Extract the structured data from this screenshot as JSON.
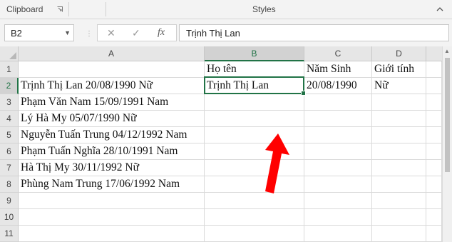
{
  "ribbon": {
    "clipboard_label": "Clipboard",
    "styles_label": "Styles"
  },
  "formula_bar": {
    "name_box": "B2",
    "fx_label": "fx",
    "cancel_icon": "x-icon",
    "enter_icon": "check-icon",
    "content": "Trịnh Thị Lan"
  },
  "columns": [
    "A",
    "B",
    "C",
    "D"
  ],
  "rows": [
    "1",
    "2",
    "3",
    "4",
    "5",
    "6",
    "7",
    "8",
    "9",
    "10",
    "11"
  ],
  "cells": {
    "A2": "Trịnh Thị Lan 20/08/1990 Nữ",
    "A3": "Phạm Văn Nam 15/09/1991 Nam",
    "A4": "Lý Hà My 05/07/1990 Nữ",
    "A5": "Nguyễn Tuấn Trung 04/12/1992 Nam",
    "A6": "Phạm Tuấn Nghĩa 28/10/1991 Nam",
    "A7": "Hà Thị My 30/11/1992 Nữ",
    "A8": "Phùng Nam Trung 17/06/1992 Nam",
    "B1": "Họ tên",
    "C1": "Năm Sinh",
    "D1": "Giới tính",
    "B2": "Trịnh Thị Lan",
    "C2": "20/08/1990",
    "D2": "Nữ"
  },
  "selection": "B2",
  "annotation": {
    "arrow_color": "#ff0000"
  },
  "colors": {
    "accent": "#217346"
  }
}
